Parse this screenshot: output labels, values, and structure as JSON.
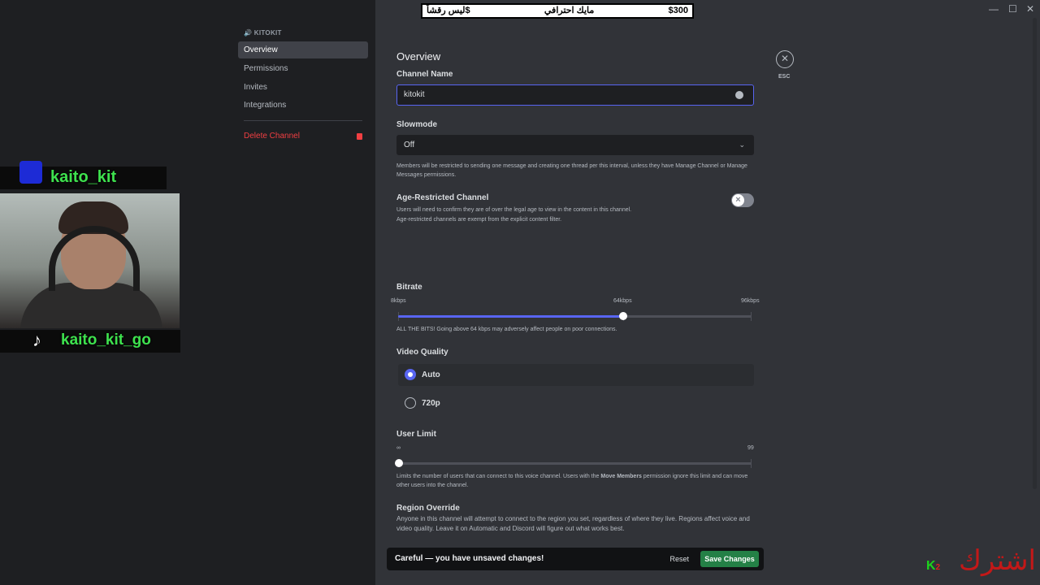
{
  "banner": {
    "price": "$300",
    "middle": "مايك احترافي",
    "right": "ليس رقشاً$"
  },
  "sidebar": {
    "category": "🔊 KITOKIT",
    "items": [
      {
        "label": "Overview"
      },
      {
        "label": "Permissions"
      },
      {
        "label": "Invites"
      },
      {
        "label": "Integrations"
      }
    ],
    "delete_label": "Delete Channel"
  },
  "main": {
    "title": "Overview",
    "channel_name_label": "Channel Name",
    "channel_name_value": "kitokit",
    "slowmode_label": "Slowmode",
    "slowmode_value": "Off",
    "slowmode_help": "Members will be restricted to sending one message and creating one thread per this interval, unless they have Manage Channel or Manage Messages permissions.",
    "age_label": "Age-Restricted Channel",
    "age_help_1": "Users will need to confirm they are of over the legal age to view in the content in this channel.",
    "age_help_2": "Age-restricted channels are exempt from the explicit content filter.",
    "age_enabled": false,
    "bitrate_label": "Bitrate",
    "bitrate_ticks": [
      "8kbps",
      "64kbps",
      "96kbps"
    ],
    "bitrate_value_kbps": 64,
    "bitrate_range": [
      8,
      96
    ],
    "bitrate_help": "ALL THE BITS! Going above 64 kbps may adversely affect people on poor connections.",
    "video_quality_label": "Video Quality",
    "video_options": [
      {
        "label": "Auto",
        "selected": true
      },
      {
        "label": "720p",
        "selected": false
      }
    ],
    "user_limit_label": "User Limit",
    "user_limit_ticks": [
      "∞",
      "99"
    ],
    "user_limit_value": 0,
    "user_limit_help_a": "Limits the number of users that can connect to this voice channel. Users with the ",
    "user_limit_help_bold": "Move Members",
    "user_limit_help_b": " permission ignore this limit and can move other users into the channel.",
    "region_label": "Region Override",
    "region_help": "Anyone in this channel will attempt to connect to the region you set, regardless of where they live. Regions affect voice and video quality. Leave it on Automatic and Discord will figure out what works best.",
    "close_label": "ESC"
  },
  "notice": {
    "text": "Careful — you have unsaved changes!",
    "reset": "Reset",
    "save": "Save Changes"
  },
  "overlay": {
    "discord_name": "kaito_kit",
    "tiktok_name": "kaito_kit_go",
    "watermark": "اشترك",
    "badge_k": "K",
    "badge_2": "2"
  },
  "colors": {
    "accent": "#5865f2",
    "save": "#248046",
    "danger": "#f23f42",
    "tag": "#3ee24e"
  }
}
